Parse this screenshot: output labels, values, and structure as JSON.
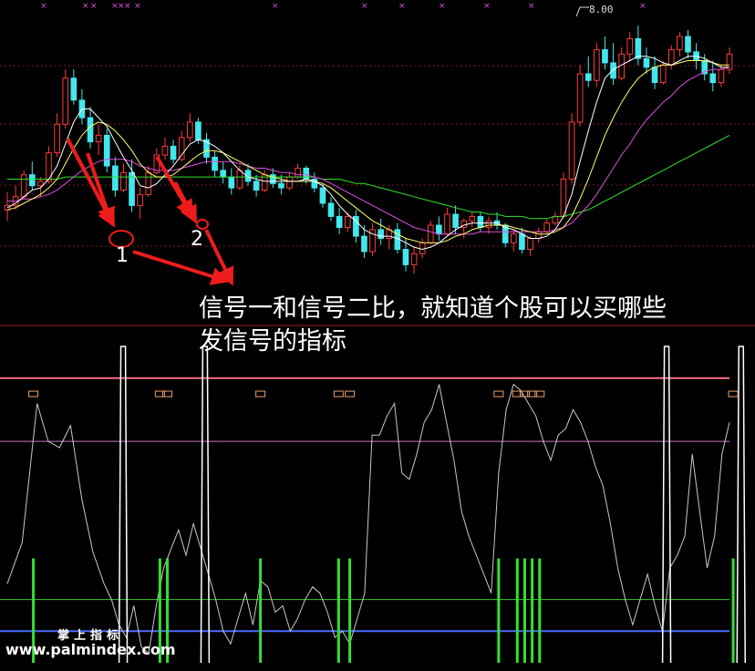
{
  "price_tag": "8.00",
  "caption": {
    "line1": "信号一和信号二比，就知道个股可以买哪些",
    "line2": "发信号的指标"
  },
  "markers": {
    "one": "1",
    "two": "2"
  },
  "watermark": {
    "name": "掌上指标",
    "url": "www.palmindex.com"
  },
  "colors": {
    "background": "#000000",
    "up": "#ff3b3b",
    "down": "#43e6ec",
    "ma_fast": "#ffffff",
    "ma_mid": "#ffff66",
    "ma_slow": "#e04de0",
    "ma_long": "#2ee52e",
    "signal_bar": "#33e033",
    "arrow": "#ee1c1c",
    "osc": "#c8c8c8",
    "top_band": "#ff6a8a",
    "mid_band": "#c878c8",
    "low_band": "#33c833",
    "base_band": "#4a6cff"
  },
  "chart_data": [
    {
      "type": "candlestick",
      "title": "",
      "annotations": [
        "8.00",
        "1",
        "2"
      ],
      "grid": true,
      "ohlc": [
        [
          0.16,
          0.24,
          0.11,
          0.18
        ],
        [
          0.18,
          0.27,
          0.16,
          0.22
        ],
        [
          0.22,
          0.34,
          0.21,
          0.32
        ],
        [
          0.32,
          0.38,
          0.25,
          0.27
        ],
        [
          0.27,
          0.31,
          0.22,
          0.29
        ],
        [
          0.29,
          0.45,
          0.28,
          0.42
        ],
        [
          0.42,
          0.6,
          0.4,
          0.55
        ],
        [
          0.55,
          0.8,
          0.53,
          0.76
        ],
        [
          0.76,
          0.8,
          0.64,
          0.66
        ],
        [
          0.66,
          0.71,
          0.55,
          0.58
        ],
        [
          0.58,
          0.63,
          0.44,
          0.47
        ],
        [
          0.47,
          0.55,
          0.41,
          0.5
        ],
        [
          0.5,
          0.53,
          0.33,
          0.36
        ],
        [
          0.36,
          0.4,
          0.22,
          0.25
        ],
        [
          0.25,
          0.37,
          0.24,
          0.33
        ],
        [
          0.33,
          0.39,
          0.15,
          0.18
        ],
        [
          0.18,
          0.26,
          0.12,
          0.23
        ],
        [
          0.23,
          0.36,
          0.22,
          0.33
        ],
        [
          0.33,
          0.44,
          0.32,
          0.41
        ],
        [
          0.41,
          0.49,
          0.39,
          0.45
        ],
        [
          0.45,
          0.48,
          0.37,
          0.39
        ],
        [
          0.39,
          0.52,
          0.38,
          0.49
        ],
        [
          0.49,
          0.6,
          0.47,
          0.56
        ],
        [
          0.56,
          0.58,
          0.46,
          0.48
        ],
        [
          0.48,
          0.51,
          0.37,
          0.4
        ],
        [
          0.4,
          0.43,
          0.31,
          0.34
        ],
        [
          0.34,
          0.38,
          0.28,
          0.31
        ],
        [
          0.31,
          0.35,
          0.23,
          0.26
        ],
        [
          0.26,
          0.36,
          0.25,
          0.34
        ],
        [
          0.34,
          0.37,
          0.27,
          0.29
        ],
        [
          0.29,
          0.32,
          0.22,
          0.25
        ],
        [
          0.25,
          0.34,
          0.24,
          0.32
        ],
        [
          0.32,
          0.35,
          0.26,
          0.28
        ],
        [
          0.28,
          0.32,
          0.23,
          0.26
        ],
        [
          0.26,
          0.33,
          0.25,
          0.31
        ],
        [
          0.31,
          0.37,
          0.3,
          0.35
        ],
        [
          0.35,
          0.36,
          0.28,
          0.3
        ],
        [
          0.3,
          0.33,
          0.24,
          0.26
        ],
        [
          0.26,
          0.28,
          0.17,
          0.19
        ],
        [
          0.19,
          0.22,
          0.11,
          0.13
        ],
        [
          0.13,
          0.17,
          0.05,
          0.08
        ],
        [
          0.08,
          0.15,
          0.06,
          0.13
        ],
        [
          0.13,
          0.16,
          0.01,
          0.04
        ],
        [
          0.04,
          0.09,
          -0.06,
          -0.03
        ],
        [
          -0.03,
          0.1,
          -0.05,
          0.07
        ],
        [
          0.07,
          0.12,
          0.0,
          0.03
        ],
        [
          0.03,
          0.09,
          -0.02,
          0.07
        ],
        [
          0.07,
          0.1,
          -0.04,
          -0.02
        ],
        [
          -0.02,
          0.03,
          -0.12,
          -0.09
        ],
        [
          -0.09,
          -0.01,
          -0.13,
          -0.04
        ],
        [
          -0.04,
          0.03,
          -0.06,
          0.01
        ],
        [
          0.01,
          0.11,
          0.0,
          0.09
        ],
        [
          0.09,
          0.13,
          0.02,
          0.05
        ],
        [
          0.05,
          0.17,
          0.04,
          0.14
        ],
        [
          0.14,
          0.18,
          0.05,
          0.08
        ],
        [
          0.08,
          0.12,
          0.03,
          0.11
        ],
        [
          0.11,
          0.15,
          0.08,
          0.13
        ],
        [
          0.13,
          0.15,
          0.06,
          0.08
        ],
        [
          0.08,
          0.13,
          0.05,
          0.11
        ],
        [
          0.11,
          0.15,
          0.07,
          0.09
        ],
        [
          0.09,
          0.1,
          -0.01,
          0.01
        ],
        [
          0.01,
          0.07,
          -0.03,
          0.05
        ],
        [
          0.05,
          0.08,
          -0.04,
          -0.02
        ],
        [
          -0.02,
          0.04,
          -0.05,
          0.03
        ],
        [
          0.03,
          0.08,
          0.01,
          0.06
        ],
        [
          0.06,
          0.12,
          0.05,
          0.1
        ],
        [
          0.1,
          0.15,
          0.09,
          0.13
        ],
        [
          0.13,
          0.33,
          0.12,
          0.3
        ],
        [
          0.3,
          0.6,
          0.28,
          0.56
        ],
        [
          0.56,
          0.82,
          0.54,
          0.78
        ],
        [
          0.78,
          0.86,
          0.72,
          0.75
        ],
        [
          0.75,
          0.92,
          0.72,
          0.89
        ],
        [
          0.89,
          0.95,
          0.8,
          0.83
        ],
        [
          0.83,
          0.92,
          0.73,
          0.76
        ],
        [
          0.76,
          0.9,
          0.75,
          0.87
        ],
        [
          0.87,
          0.97,
          0.84,
          0.94
        ],
        [
          0.94,
          1.0,
          0.82,
          0.85
        ],
        [
          0.85,
          0.9,
          0.78,
          0.81
        ],
        [
          0.81,
          0.86,
          0.71,
          0.74
        ],
        [
          0.74,
          0.84,
          0.73,
          0.82
        ],
        [
          0.82,
          0.91,
          0.8,
          0.89
        ],
        [
          0.89,
          0.97,
          0.86,
          0.95
        ],
        [
          0.95,
          0.98,
          0.85,
          0.88
        ],
        [
          0.88,
          0.92,
          0.8,
          0.84
        ],
        [
          0.84,
          0.87,
          0.75,
          0.78
        ],
        [
          0.78,
          0.84,
          0.7,
          0.74
        ],
        [
          0.74,
          0.82,
          0.72,
          0.8
        ],
        [
          0.8,
          0.9,
          0.78,
          0.87
        ]
      ],
      "ma_fast": [
        0.17,
        0.19,
        0.22,
        0.25,
        0.26,
        0.3,
        0.36,
        0.46,
        0.56,
        0.62,
        0.62,
        0.58,
        0.54,
        0.47,
        0.4,
        0.34,
        0.27,
        0.26,
        0.28,
        0.32,
        0.36,
        0.41,
        0.46,
        0.48,
        0.47,
        0.45,
        0.42,
        0.38,
        0.34,
        0.31,
        0.3,
        0.29,
        0.29,
        0.29,
        0.29,
        0.29,
        0.3,
        0.29,
        0.27,
        0.23,
        0.18,
        0.14,
        0.11,
        0.07,
        0.05,
        0.04,
        0.04,
        0.03,
        0.01,
        -0.01,
        -0.02,
        -0.01,
        0.01,
        0.04,
        0.07,
        0.09,
        0.1,
        0.1,
        0.1,
        0.1,
        0.08,
        0.07,
        0.05,
        0.03,
        0.03,
        0.04,
        0.07,
        0.13,
        0.23,
        0.38,
        0.52,
        0.65,
        0.76,
        0.8,
        0.82,
        0.84,
        0.86,
        0.86,
        0.85,
        0.83,
        0.82,
        0.84,
        0.86,
        0.86,
        0.85,
        0.83,
        0.81,
        0.81
      ],
      "ma_mid": [
        0.16,
        0.17,
        0.19,
        0.21,
        0.23,
        0.26,
        0.3,
        0.37,
        0.44,
        0.5,
        0.54,
        0.56,
        0.55,
        0.52,
        0.48,
        0.43,
        0.37,
        0.33,
        0.31,
        0.31,
        0.32,
        0.35,
        0.38,
        0.41,
        0.43,
        0.43,
        0.42,
        0.4,
        0.38,
        0.36,
        0.34,
        0.32,
        0.31,
        0.3,
        0.29,
        0.29,
        0.29,
        0.29,
        0.28,
        0.26,
        0.23,
        0.2,
        0.17,
        0.14,
        0.11,
        0.09,
        0.07,
        0.05,
        0.03,
        0.02,
        0.01,
        0.01,
        0.01,
        0.02,
        0.04,
        0.05,
        0.07,
        0.08,
        0.09,
        0.09,
        0.09,
        0.08,
        0.07,
        0.06,
        0.05,
        0.05,
        0.06,
        0.08,
        0.13,
        0.21,
        0.3,
        0.4,
        0.5,
        0.58,
        0.65,
        0.71,
        0.76,
        0.79,
        0.81,
        0.82,
        0.82,
        0.83,
        0.84,
        0.84,
        0.84,
        0.83,
        0.82,
        0.82
      ],
      "ma_slow": [
        0.2,
        0.2,
        0.21,
        0.21,
        0.22,
        0.23,
        0.25,
        0.28,
        0.31,
        0.34,
        0.36,
        0.38,
        0.39,
        0.39,
        0.39,
        0.38,
        0.36,
        0.35,
        0.34,
        0.34,
        0.34,
        0.35,
        0.36,
        0.37,
        0.38,
        0.38,
        0.38,
        0.38,
        0.37,
        0.36,
        0.35,
        0.35,
        0.34,
        0.33,
        0.33,
        0.32,
        0.32,
        0.31,
        0.3,
        0.28,
        0.26,
        0.24,
        0.22,
        0.2,
        0.18,
        0.16,
        0.14,
        0.12,
        0.1,
        0.08,
        0.07,
        0.06,
        0.05,
        0.05,
        0.05,
        0.05,
        0.05,
        0.06,
        0.06,
        0.06,
        0.06,
        0.06,
        0.06,
        0.06,
        0.06,
        0.06,
        0.07,
        0.08,
        0.1,
        0.14,
        0.18,
        0.23,
        0.29,
        0.35,
        0.41,
        0.46,
        0.52,
        0.57,
        0.61,
        0.65,
        0.68,
        0.72,
        0.75,
        0.77,
        0.79,
        0.8,
        0.8,
        0.81
      ],
      "ma_long": [
        0.3,
        0.3,
        0.3,
        0.3,
        0.3,
        0.3,
        0.3,
        0.31,
        0.31,
        0.31,
        0.31,
        0.31,
        0.31,
        0.31,
        0.31,
        0.31,
        0.31,
        0.31,
        0.31,
        0.31,
        0.31,
        0.31,
        0.31,
        0.31,
        0.31,
        0.31,
        0.31,
        0.31,
        0.31,
        0.31,
        0.31,
        0.31,
        0.31,
        0.31,
        0.31,
        0.31,
        0.31,
        0.31,
        0.3,
        0.3,
        0.3,
        0.29,
        0.28,
        0.28,
        0.27,
        0.26,
        0.25,
        0.24,
        0.23,
        0.22,
        0.21,
        0.2,
        0.19,
        0.18,
        0.17,
        0.16,
        0.15,
        0.15,
        0.14,
        0.14,
        0.13,
        0.13,
        0.13,
        0.12,
        0.12,
        0.12,
        0.13,
        0.13,
        0.14,
        0.15,
        0.16,
        0.18,
        0.2,
        0.22,
        0.24,
        0.26,
        0.28,
        0.3,
        0.32,
        0.34,
        0.36,
        0.38,
        0.4,
        0.42,
        0.44,
        0.46,
        0.48,
        0.5
      ]
    },
    {
      "type": "line",
      "title": "",
      "ylim": [
        0,
        100
      ],
      "grid": false,
      "bands": [
        100,
        90,
        70,
        20,
        10
      ],
      "oscillator": [
        [
          0,
          25
        ],
        [
          4,
          38
        ],
        [
          8,
          82
        ],
        [
          11,
          70
        ],
        [
          14,
          68
        ],
        [
          17,
          75
        ],
        [
          20,
          52
        ],
        [
          23,
          35
        ],
        [
          26,
          25
        ],
        [
          28,
          20
        ],
        [
          30,
          12
        ],
        [
          32,
          8
        ],
        [
          34,
          18
        ],
        [
          36,
          5
        ],
        [
          38,
          3
        ],
        [
          40,
          18
        ],
        [
          42,
          30
        ],
        [
          44,
          36
        ],
        [
          46,
          42
        ],
        [
          48,
          34
        ],
        [
          50,
          44
        ],
        [
          52,
          36
        ],
        [
          54,
          28
        ],
        [
          56,
          20
        ],
        [
          58,
          10
        ],
        [
          60,
          6
        ],
        [
          62,
          14
        ],
        [
          64,
          22
        ],
        [
          66,
          12
        ],
        [
          68,
          26
        ],
        [
          70,
          24
        ],
        [
          72,
          16
        ],
        [
          74,
          18
        ],
        [
          76,
          10
        ],
        [
          78,
          14
        ],
        [
          80,
          20
        ],
        [
          82,
          24
        ],
        [
          84,
          22
        ],
        [
          86,
          16
        ],
        [
          88,
          8
        ],
        [
          90,
          10
        ],
        [
          92,
          6
        ],
        [
          94,
          14
        ],
        [
          96,
          22
        ],
        [
          98,
          72
        ],
        [
          100,
          72
        ],
        [
          102,
          78
        ],
        [
          104,
          82
        ],
        [
          106,
          60
        ],
        [
          108,
          58
        ],
        [
          110,
          66
        ],
        [
          112,
          76
        ],
        [
          114,
          80
        ],
        [
          116,
          88
        ],
        [
          118,
          76
        ],
        [
          120,
          64
        ],
        [
          122,
          48
        ],
        [
          124,
          40
        ],
        [
          126,
          34
        ],
        [
          128,
          28
        ],
        [
          130,
          22
        ],
        [
          132,
          60
        ],
        [
          134,
          80
        ],
        [
          136,
          88
        ],
        [
          138,
          86
        ],
        [
          140,
          82
        ],
        [
          142,
          78
        ],
        [
          144,
          70
        ],
        [
          146,
          64
        ],
        [
          148,
          72
        ],
        [
          150,
          74
        ],
        [
          152,
          80
        ],
        [
          154,
          76
        ],
        [
          156,
          70
        ],
        [
          158,
          62
        ],
        [
          160,
          56
        ],
        [
          162,
          44
        ],
        [
          164,
          30
        ],
        [
          166,
          20
        ],
        [
          168,
          12
        ],
        [
          170,
          20
        ],
        [
          172,
          28
        ],
        [
          174,
          18
        ],
        [
          176,
          10
        ],
        [
          178,
          30
        ],
        [
          180,
          34
        ],
        [
          182,
          40
        ],
        [
          184,
          66
        ],
        [
          186,
          48
        ],
        [
          188,
          30
        ],
        [
          190,
          40
        ],
        [
          192,
          66
        ],
        [
          194,
          76
        ]
      ],
      "spikes": [
        31,
        53,
        177,
        197
      ],
      "signals": [
        7,
        41,
        43,
        68,
        89,
        92,
        132,
        137,
        139,
        141,
        143,
        195
      ],
      "signal_value": 33,
      "signal_mark_value": 85
    }
  ]
}
